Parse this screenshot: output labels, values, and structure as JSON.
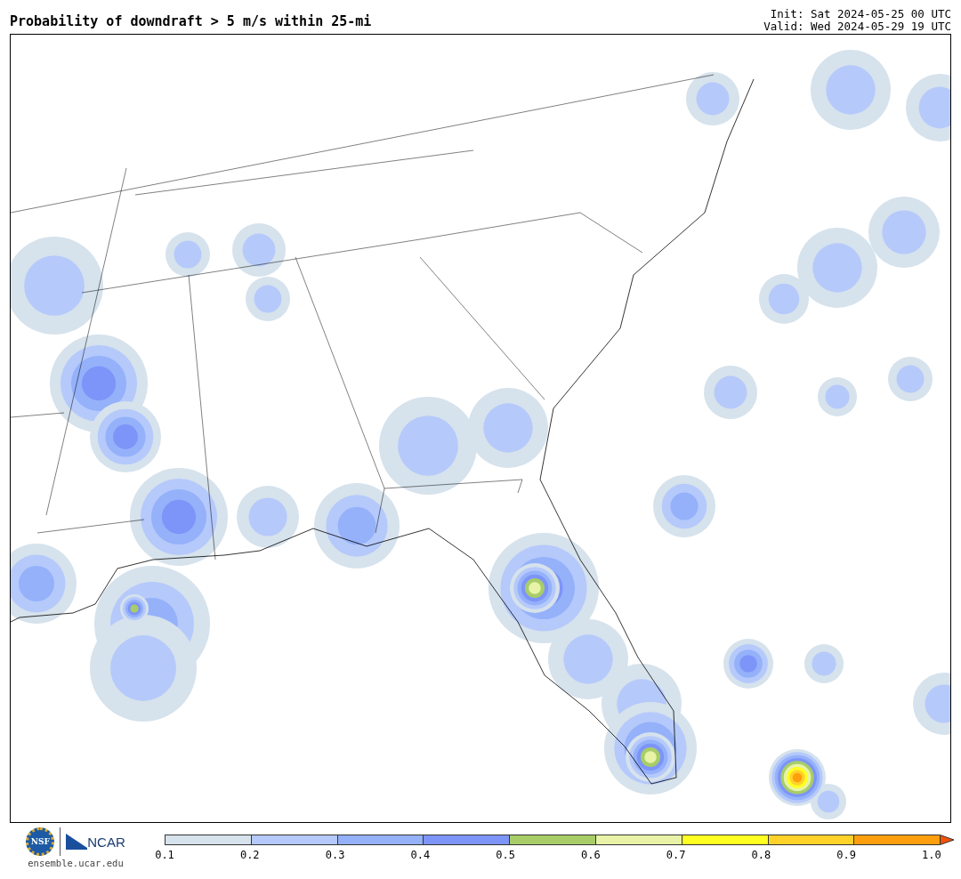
{
  "title": "Probability of downdraft > 5 m/s within 25-mi",
  "init": "Init: Sat 2024-05-25 00 UTC",
  "valid": "Valid: Wed 2024-05-29 19 UTC",
  "logo": {
    "nsf": "NSF",
    "ncar": "NCAR",
    "url": "ensemble.ucar.edu"
  },
  "colorbar": {
    "bins": [
      {
        "color": "#d6e2ec"
      },
      {
        "color": "#b5c9fb"
      },
      {
        "color": "#94b1fa"
      },
      {
        "color": "#7d94f8"
      },
      {
        "color": "#a8cd68"
      },
      {
        "color": "#e8f3a8"
      },
      {
        "color": "#ffff22"
      },
      {
        "color": "#ffd22a"
      },
      {
        "color": "#ff9f0e"
      },
      {
        "kind": "arrow",
        "color": "#f0520a"
      }
    ],
    "ticks": [
      "0.1",
      "0.2",
      "0.3",
      "0.4",
      "0.5",
      "0.6",
      "0.7",
      "0.8",
      "0.9",
      "1.0"
    ]
  }
}
